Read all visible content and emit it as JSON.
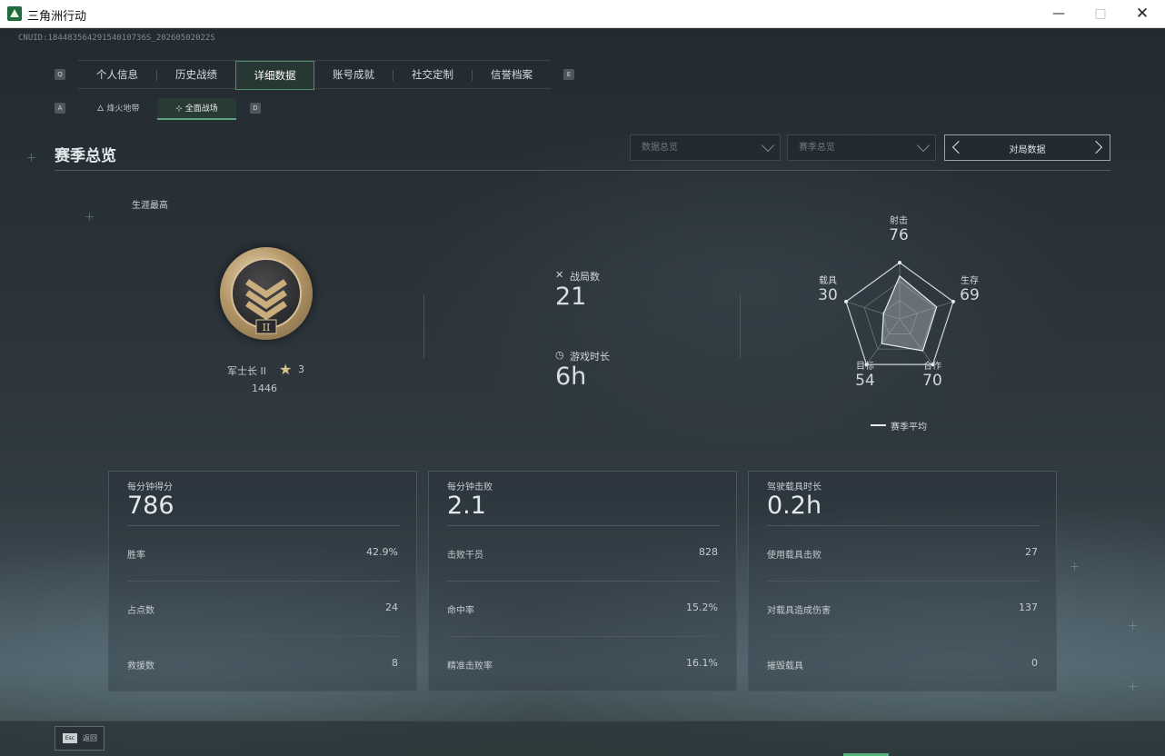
{
  "window": {
    "title": "三角洲行动",
    "minimize": "—",
    "maximize": "□",
    "close": "✕"
  },
  "cnuid": "CNUID:18448356429154010736S_20260502022S",
  "tabs": {
    "prev_key": "Q",
    "next_key": "E",
    "items": [
      {
        "label": "个人信息"
      },
      {
        "label": "历史战绩"
      },
      {
        "label": "详细数据"
      },
      {
        "label": "账号成就"
      },
      {
        "label": "社交定制"
      },
      {
        "label": "信誉档案"
      }
    ],
    "active_index": 2
  },
  "subtabs": {
    "prev_key": "A",
    "next_key": "D",
    "items": [
      {
        "label": "烽火地带",
        "icon": "flame-icon"
      },
      {
        "label": "全面战场",
        "icon": "crosshair-icon"
      }
    ],
    "active_index": 1
  },
  "section": {
    "title": "赛季总览"
  },
  "filters": {
    "data_overview": "数据总览",
    "season_overview": "赛季总览",
    "pager_label": "对局数据"
  },
  "rank": {
    "career_label": "生涯最高",
    "name": "军士长 II",
    "stars": "3",
    "score": "1446",
    "medal_numeral": "II"
  },
  "center": {
    "matches_label": "战局数",
    "matches_value": "21",
    "playtime_label": "游戏时长",
    "playtime_value": "6h"
  },
  "radar": {
    "axes": [
      {
        "label": "射击",
        "value": 76
      },
      {
        "label": "生存",
        "value": 69
      },
      {
        "label": "合作",
        "value": 70
      },
      {
        "label": "目标",
        "value": 54
      },
      {
        "label": "载具",
        "value": 30
      }
    ],
    "legend": "赛季平均"
  },
  "cards": [
    {
      "title": "每分钟得分",
      "big": "786",
      "rows": [
        {
          "label": "胜率",
          "value": "42.9%"
        },
        {
          "label": "占点数",
          "value": "24"
        },
        {
          "label": "救援数",
          "value": "8"
        }
      ]
    },
    {
      "title": "每分钟击败",
      "big": "2.1",
      "rows": [
        {
          "label": "击败干员",
          "value": "828"
        },
        {
          "label": "命中率",
          "value": "15.2%"
        },
        {
          "label": "精准击败率",
          "value": "16.1%"
        }
      ]
    },
    {
      "title": "驾驶载具时长",
      "big": "0.2h",
      "rows": [
        {
          "label": "使用载具击败",
          "value": "27"
        },
        {
          "label": "对载具造成伤害",
          "value": "137"
        },
        {
          "label": "摧毁载具",
          "value": "0"
        }
      ]
    }
  ],
  "bottom": {
    "esc_key": "Esc",
    "esc_label": "返回"
  },
  "colors": {
    "accent": "#5ca581",
    "panel_border": "#4b555a",
    "text": "#c9d0d4"
  }
}
